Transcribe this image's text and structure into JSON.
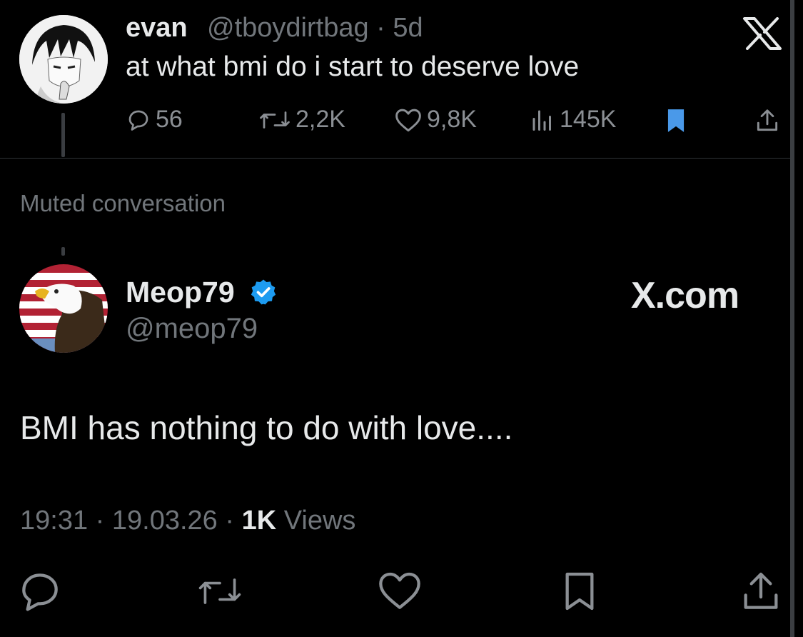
{
  "top_tweet": {
    "author_name": "evan",
    "handle_time": "@tboydirtbag · 5d",
    "text": "at what bmi do i start to deserve love",
    "metrics": {
      "replies": "56",
      "reposts": "2,2K",
      "likes": "9,8K",
      "views": "145K"
    },
    "bookmark_color": "#4a99e9"
  },
  "muted_label": "Muted conversation",
  "reply_tweet": {
    "author_name": "Meop79",
    "handle": "@meop79",
    "brand": "X.com",
    "text": "BMI has nothing to do with love....",
    "time": "19:31",
    "date": "19.03.26",
    "views_count": "1K",
    "views_label": "Views",
    "verified_color": "#1d9bf0"
  },
  "icons": {
    "top": [
      "x-logo",
      "reply-icon",
      "repost-icon",
      "like-icon",
      "views-icon",
      "bookmark-icon",
      "share-icon"
    ],
    "bottom": [
      "reply-icon",
      "repost-icon",
      "like-icon",
      "bookmark-icon",
      "share-icon"
    ]
  }
}
